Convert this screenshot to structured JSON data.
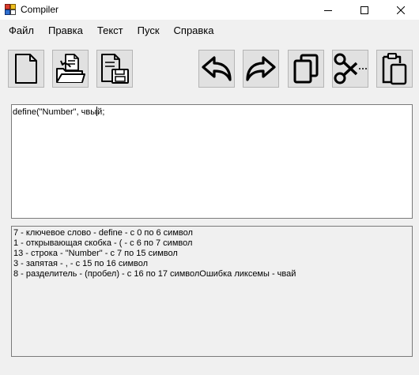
{
  "window": {
    "title": "Compiler",
    "controls": [
      {
        "name": "minimize-button",
        "icon": "minimize-icon"
      },
      {
        "name": "maximize-button",
        "icon": "maximize-icon"
      },
      {
        "name": "close-button",
        "icon": "close-icon"
      }
    ]
  },
  "menu": {
    "items": [
      "Файл",
      "Правка",
      "Текст",
      "Пуск",
      "Справка"
    ]
  },
  "toolbar": {
    "buttons": [
      {
        "name": "new-file-button",
        "icon": "new-file-icon"
      },
      {
        "name": "open-file-button",
        "icon": "open-folder-icon"
      },
      {
        "name": "save-file-button",
        "icon": "save-icon"
      },
      {
        "name": "undo-button",
        "icon": "undo-icon"
      },
      {
        "name": "redo-button",
        "icon": "redo-icon"
      },
      {
        "name": "copy-button",
        "icon": "copy-icon"
      },
      {
        "name": "cut-button",
        "icon": "scissors-icon"
      },
      {
        "name": "paste-button",
        "icon": "clipboard-icon"
      }
    ]
  },
  "editor": {
    "text_before_caret": "define(\"Number\", чвы",
    "text_after_caret": "й;"
  },
  "output": {
    "lines": [
      "7 - ключевое слово - define - с 0 по 6 символ",
      "1 - открывающая скобка - ( - с 6 по 7 символ",
      "13 - строка - \"Number\" - с 7 по 15 символ",
      "3 - запятая - , - с 15 по 16 символ",
      "8 - разделитель - (пробел) - с 16 по 17 символОшибка ликсемы - чвай"
    ]
  }
}
